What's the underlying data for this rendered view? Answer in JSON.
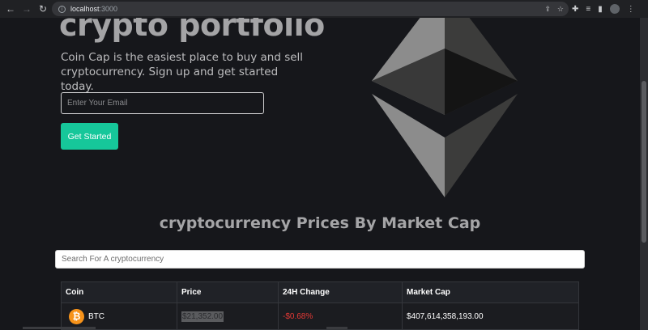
{
  "browser": {
    "back_glyph": "←",
    "forward_glyph": "→",
    "reload_glyph": "↻",
    "url_host": "localhost",
    "url_port": ":3000",
    "info_glyph": "i",
    "share_glyph": "⇪",
    "bookmark_glyph": "☆",
    "extensions_glyph": "✚",
    "media_glyph": "≡",
    "sidepanel_glyph": "▮",
    "menu_glyph": "⋮"
  },
  "hero": {
    "title": "crypto portfolio",
    "description": "Coin Cap is the easiest place to buy and sell cryptocurrency. Sign up and get started today.",
    "email_placeholder": "Enter Your Email",
    "cta_label": "Get Started"
  },
  "prices": {
    "title": "cryptocurrency Prices By Market Cap",
    "search_placeholder": "Search For A cryptocurrency",
    "columns": [
      "Coin",
      "Price",
      "24H Change",
      "Market Cap"
    ],
    "rows": [
      {
        "icon_glyph": "₿",
        "coin": "BTC",
        "price": "$21,352.00",
        "change": "-$0.68%",
        "market_cap": "$407,614,358,193.00"
      }
    ]
  },
  "colors": {
    "background": "#16171b",
    "accent": "#16c79a",
    "negative": "#e53935",
    "btc": "#f7931a"
  }
}
